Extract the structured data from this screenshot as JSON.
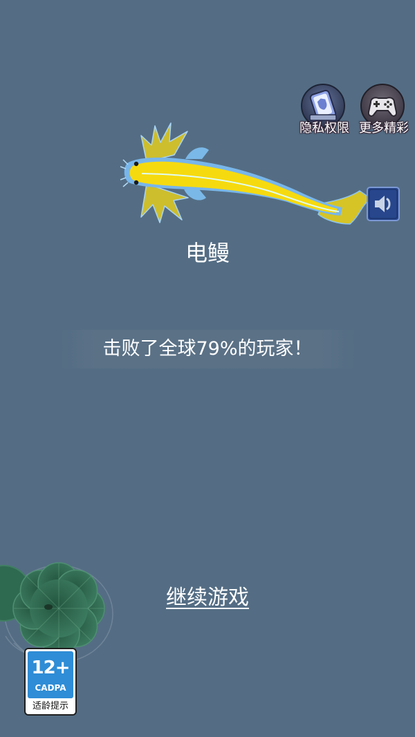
{
  "screen": {
    "background_color": "#546d84"
  },
  "corner_menu": {
    "privacy": {
      "label": "隐私权限",
      "icon": "privacy-phone-icon"
    },
    "more_games": {
      "label": "更多精彩",
      "icon": "gamepad-icon"
    }
  },
  "sound_button": {
    "icon": "speaker-icon",
    "color": "#27468c"
  },
  "fish": {
    "name": "电鳗",
    "icon": "electric-eel-icon",
    "colors": {
      "body": "#f6da10",
      "edge": "#78b6ea",
      "lateral_line": "#dffcf4"
    }
  },
  "result": {
    "text": "击败了全球79%的玩家！"
  },
  "continue_button": {
    "label": "继续游戏"
  },
  "age_rating": {
    "rating": "12+",
    "organization": "CADPA",
    "caption": "适龄提示",
    "color": "#2e8dd6"
  },
  "decoration": {
    "icon": "lily-pad-icon",
    "color": "#2e6a50"
  }
}
